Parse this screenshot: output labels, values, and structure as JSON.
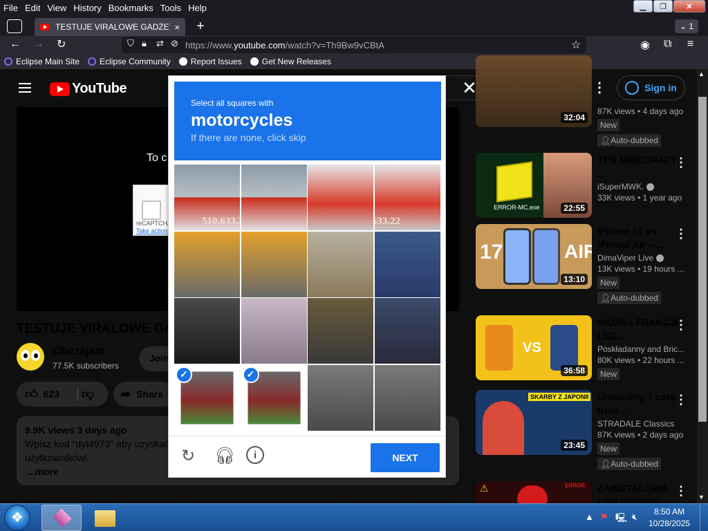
{
  "menu": [
    "File",
    "Edit",
    "View",
    "History",
    "Bookmarks",
    "Tools",
    "Help"
  ],
  "window_controls": {
    "tab_count": "1"
  },
  "tab": {
    "title": "TESTUJE VIRALOWE GADŻETY D",
    "close": "×"
  },
  "url": {
    "prefix": "https://www.",
    "host": "youtube.com",
    "path": "/watch?v=Th9Bw9vCBtA"
  },
  "bookmarks": [
    "Eclipse Main Site",
    "Eclipse Community",
    "Report Issues",
    "Get New Releases"
  ],
  "yt": {
    "logo": "YouTube",
    "sign_in": "Sign in",
    "player_text": "To c",
    "recaptcha_label": "reCAPTCHA",
    "recaptcha_action": "Take action",
    "video_title": "TESTUJE VIRALOWE GA",
    "channel": "Obczajam",
    "subscribers": "77.5K subscribers",
    "join": "Join",
    "likes": "623",
    "share": "Share",
    "desc_meta": "9.9K views  3 days ago",
    "desc_line1": "Wpisz kod \"dyt4973\" aby uzyskać",
    "desc_line2": "użytkowników!",
    "more": "...more"
  },
  "related": [
    {
      "title": "",
      "channel": "",
      "views": "87K views • 4 days ago",
      "duration": "32:04",
      "badges": [
        "New",
        "Auto-dubbed"
      ]
    },
    {
      "title": "TEN MINECRAFT ...",
      "channel": "iSuperMWK.",
      "views": "33K views • 1 year ago",
      "duration": "22:55",
      "thumb_text": "ERROR-MC.exe",
      "badges": []
    },
    {
      "title": "iPhone 17 vs. iPhone Air – ...",
      "channel": "DimaViper Live",
      "views": "13K views • 19 hours ...",
      "duration": "13:10",
      "thumb_left": "17",
      "thumb_right": "AIR",
      "badges": [
        "New",
        "Auto-dubbed"
      ]
    },
    {
      "title": "WOJNA FRAKCJI LEG...",
      "channel": "Poskładanny and Bric...",
      "views": "80K views • 22 hours ...",
      "duration": "36:58",
      "thumb_text": "VS",
      "badges": [
        "New"
      ]
    },
    {
      "title": "Unloading 7 cars from ...",
      "channel": "STRADALE Classics",
      "views": "87K views • 2 days ago",
      "duration": "23:45",
      "thumb_text": "SKARBY Z JAPONII",
      "badges": [
        "New",
        "Auto-dubbed"
      ]
    },
    {
      "title": "ZAINSTALOWA ŁEM DZIWNE ...",
      "channel": "",
      "views": "",
      "duration": "",
      "thumb_text": "ERROR",
      "badges": []
    }
  ],
  "captcha": {
    "instruction": "Select all squares with",
    "target": "motorcycles",
    "hint": "If there are none, click skip",
    "next": "NEXT",
    "tile_label_1": "510.633.22",
    "tile_label_2": "510.633.22",
    "selected_tiles": [
      12,
      13
    ]
  },
  "taskbar": {
    "time": "8:50 AM",
    "date": "10/28/2025"
  },
  "colors": {
    "captcha_blue": "#1a73e8",
    "yt_red": "#ff0000"
  }
}
